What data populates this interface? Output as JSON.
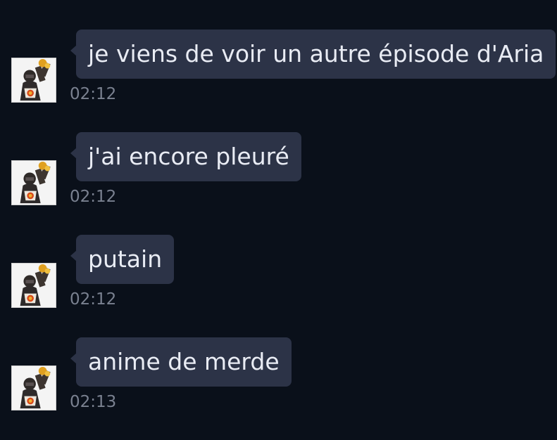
{
  "messages": [
    {
      "text": "je viens de voir un autre épisode d'Aria",
      "time": "02:12",
      "avatar_icon": "praise-the-sun-avatar-icon"
    },
    {
      "text": "j'ai encore pleuré",
      "time": "02:12",
      "avatar_icon": "praise-the-sun-avatar-icon"
    },
    {
      "text": "putain",
      "time": "02:12",
      "avatar_icon": "praise-the-sun-avatar-icon"
    },
    {
      "text": "anime de merde",
      "time": "02:13",
      "avatar_icon": "praise-the-sun-avatar-icon"
    }
  ],
  "colors": {
    "background": "#0a101a",
    "bubble": "#2c3347",
    "bubble_text": "#e9ecf4",
    "timestamp": "#7a8190"
  }
}
